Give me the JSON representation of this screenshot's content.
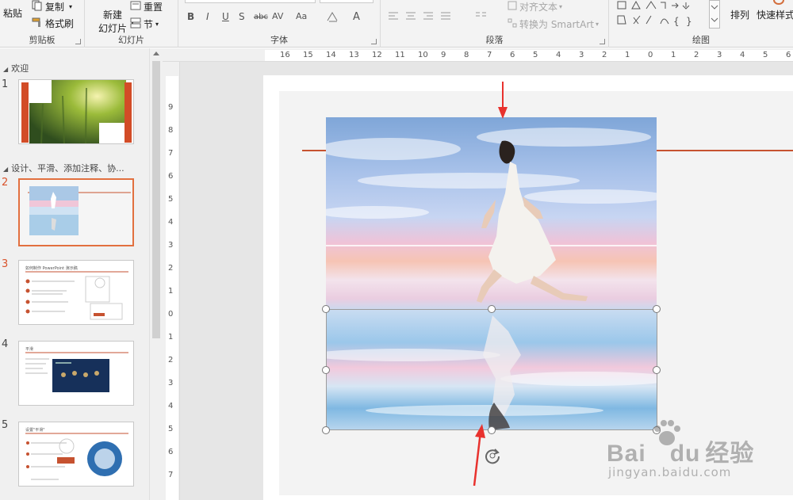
{
  "ribbon": {
    "clipboard": {
      "paste": "粘贴",
      "copy": "复制",
      "format_painter": "格式刷",
      "label": "剪贴板"
    },
    "slides": {
      "new_slide": "新建",
      "new_slide_2": "幻灯片",
      "reset": "重置",
      "section": "节",
      "label": "幻灯片"
    },
    "font": {
      "label": "字体",
      "bold": "B",
      "italic": "I",
      "underline": "U",
      "shadow": "S",
      "strike": "abc",
      "spacing": "AV",
      "case": "Aa",
      "color": "A"
    },
    "paragraph": {
      "label": "段落",
      "align_text": "对齐文本",
      "convert_smartart": "转换为 SmartArt"
    },
    "drawing": {
      "label": "绘图",
      "arrange": "排列",
      "quick_styles": "快速样式"
    }
  },
  "slides_pane": {
    "sections": [
      {
        "title": "欢迎"
      },
      {
        "title": "设计、平滑、添加注释、协..."
      }
    ],
    "thumbnails": [
      {
        "num": "1"
      },
      {
        "num": "2",
        "selected": true
      },
      {
        "num": "3",
        "title": "如何制作 PowerPoint 演示稿"
      },
      {
        "num": "4",
        "title": "平滑"
      },
      {
        "num": "5",
        "title": "设置\"平滑\""
      }
    ]
  },
  "hruler": [
    "16",
    "15",
    "14",
    "13",
    "12",
    "11",
    "10",
    "9",
    "8",
    "7",
    "6",
    "5",
    "4",
    "3",
    "2",
    "1",
    "0",
    "1",
    "2",
    "3",
    "4",
    "5",
    "6"
  ],
  "vruler": [
    "9",
    "8",
    "7",
    "6",
    "5",
    "4",
    "3",
    "2",
    "1",
    "0",
    "1",
    "2",
    "3",
    "4",
    "5",
    "6",
    "7"
  ],
  "watermark": {
    "brand": "Bai",
    "brand2": "du",
    "cn": "经验",
    "url": "jingyan.baidu.com"
  },
  "colors": {
    "accent": "#c65230",
    "arrow": "#e8322e",
    "selected_border": "#e2703f"
  }
}
